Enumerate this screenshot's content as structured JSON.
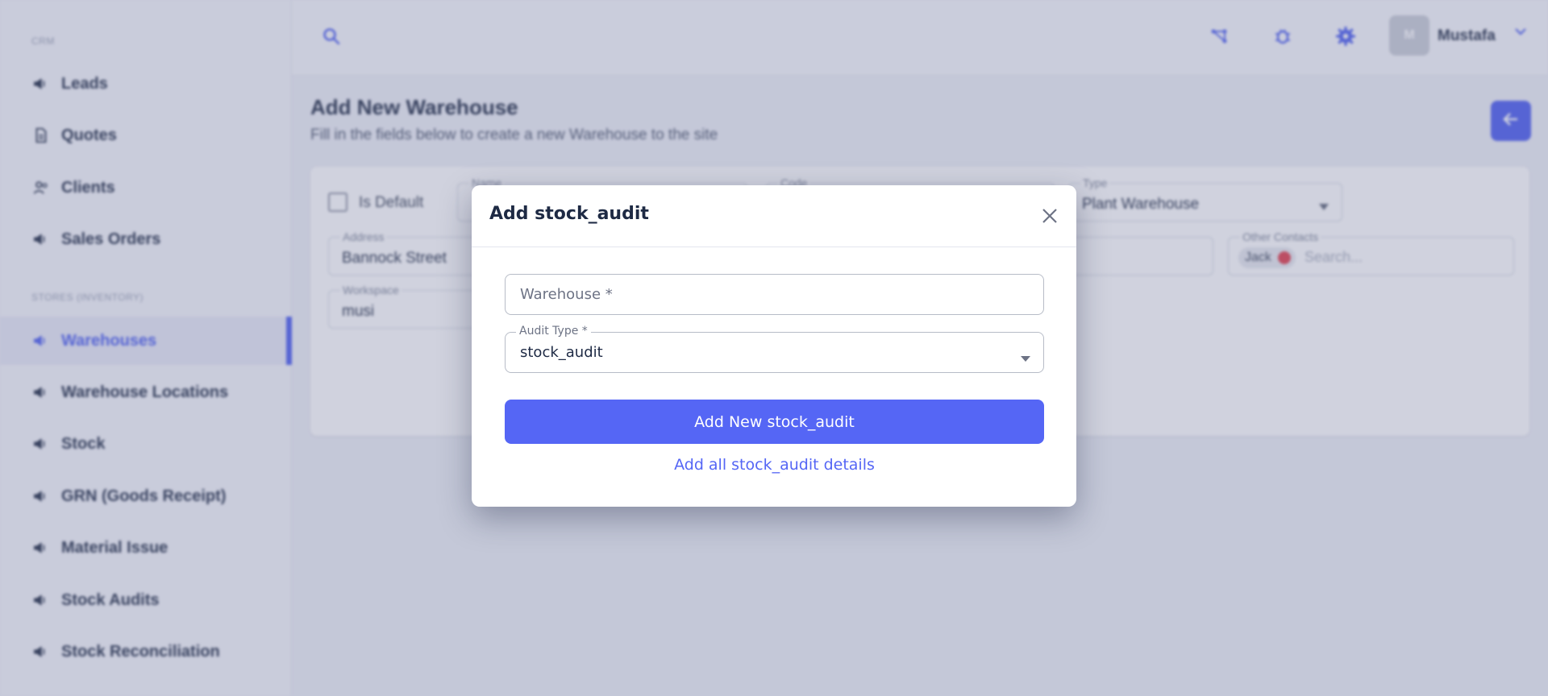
{
  "sidebar": {
    "section_crm": "CRM",
    "section_stores": "STORES (INVENTORY)",
    "items": [
      {
        "label": "Leads",
        "icon": "megaphone-icon"
      },
      {
        "label": "Quotes",
        "icon": "document-icon"
      },
      {
        "label": "Clients",
        "icon": "people-icon"
      },
      {
        "label": "Sales Orders",
        "icon": "megaphone-icon"
      },
      {
        "label": "Warehouses",
        "icon": "megaphone-icon",
        "active": true
      },
      {
        "label": "Warehouse Locations",
        "icon": "megaphone-icon"
      },
      {
        "label": "Stock",
        "icon": "megaphone-icon"
      },
      {
        "label": "GRN (Goods Receipt)",
        "icon": "megaphone-icon"
      },
      {
        "label": "Material Issue",
        "icon": "megaphone-icon"
      },
      {
        "label": "Stock Audits",
        "icon": "megaphone-icon"
      },
      {
        "label": "Stock Reconciliation",
        "icon": "megaphone-icon"
      }
    ]
  },
  "topbar": {
    "avatar_initial": "M",
    "user_name": "Mustafa",
    "icons": [
      "search-icon",
      "share-icon",
      "bug-icon",
      "gear-icon",
      "chevron-down-icon"
    ]
  },
  "page": {
    "title": "Add New Warehouse",
    "subtitle": "Fill in the fields below to create a new Warehouse to the site"
  },
  "form": {
    "is_default_label": "Is Default",
    "name_label": "Name",
    "code_label": "Code",
    "type_label": "Type",
    "type_value": "Plant Warehouse",
    "address_label": "Address",
    "address_value": "Bannock Street",
    "other_contacts_label": "Other Contacts",
    "contact_chip": "Jack",
    "contacts_search_placeholder": "Search...",
    "workspace_label": "Workspace",
    "workspace_value": "musi"
  },
  "modal": {
    "title": "Add stock_audit",
    "warehouse_placeholder": "Warehouse *",
    "audit_type_label": "Audit Type *",
    "audit_type_value": "stock_audit",
    "primary_button": "Add New stock_audit",
    "details_link": "Add all stock_audit details"
  },
  "colors": {
    "accent": "#5566f5",
    "sidebar_active": "#4a5cf0",
    "text_dark": "#1e2a44"
  }
}
